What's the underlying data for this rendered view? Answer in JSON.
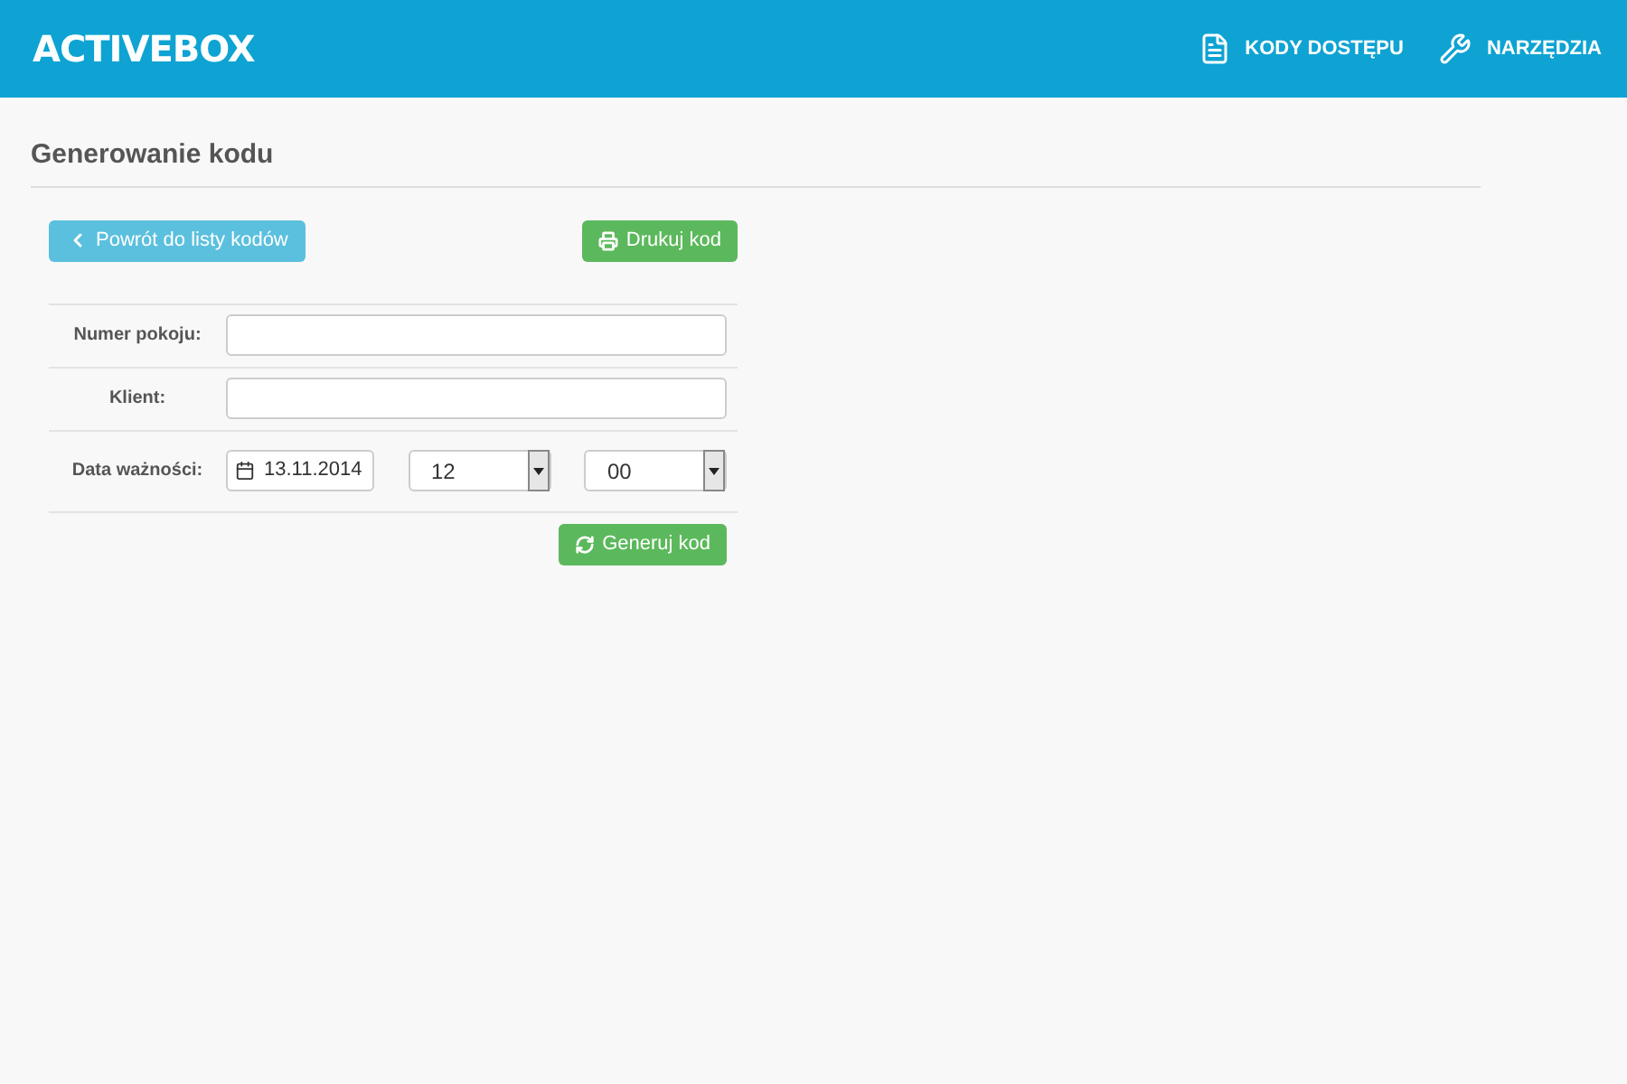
{
  "header": {
    "logo": "ACTIVEBOX",
    "nav": [
      {
        "label": "KODY DOSTĘPU",
        "kind": "document"
      },
      {
        "label": "NARZĘDZIA",
        "kind": "wrench"
      }
    ]
  },
  "page": {
    "title": "Generowanie kodu"
  },
  "actions": {
    "back": "Powrót do listy kodów",
    "print": "Drukuj kod"
  },
  "form": {
    "rows": [
      {
        "label": "Numer pokoju:",
        "kind": "text"
      },
      {
        "label": "Klient:",
        "kind": "text"
      },
      {
        "label": "Data ważności:",
        "kind": "datetime",
        "date": "13.11.2014",
        "hour": "12",
        "minute": "00"
      }
    ]
  },
  "submit": "Generuj kod"
}
